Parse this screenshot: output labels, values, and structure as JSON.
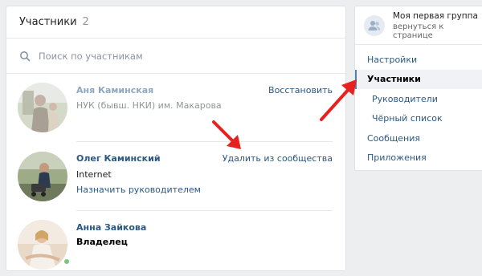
{
  "members_panel": {
    "title": "Участники",
    "count": "2",
    "search_placeholder": "Поиск по участникам"
  },
  "members": [
    {
      "name": "Аня Каминская",
      "line1": "НУК (бывш. НКИ) им. Макарова",
      "action": "Восстановить"
    },
    {
      "name": "Олег Каминский",
      "line1": "Internet",
      "line2": "Назначить руководителем",
      "action": "Удалить из сообщества"
    },
    {
      "name": "Анна Зайкова",
      "line1": "Владелец"
    }
  ],
  "group": {
    "name": "Моя первая группа",
    "back_link": "вернуться к странице"
  },
  "menu": [
    {
      "label": "Настройки"
    },
    {
      "label": "Участники",
      "active": true
    },
    {
      "label": "Руководители"
    },
    {
      "label": "Чёрный список"
    },
    {
      "label": "Сообщения"
    },
    {
      "label": "Приложения"
    }
  ],
  "colors": {
    "link": "#2a5885",
    "annotation_arrow": "#e8201e",
    "online": "#7ac47f"
  }
}
